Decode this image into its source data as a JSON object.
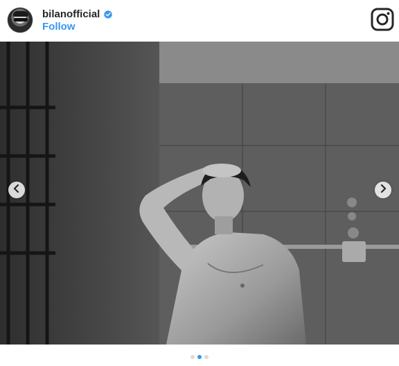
{
  "post": {
    "username": "bilanofficial",
    "follow_label": "Follow",
    "verified": true,
    "photo_description_alt": "",
    "carousel": {
      "count": 3,
      "active_index": 1
    }
  },
  "icons": {
    "avatar": "profile-avatar",
    "verified": "verified-badge-icon",
    "brand": "instagram-icon",
    "prev": "chevron-left-icon",
    "next": "chevron-right-icon"
  },
  "colors": {
    "link": "#3897f0",
    "text": "#262626",
    "dot_inactive": "#dbdbdb"
  }
}
